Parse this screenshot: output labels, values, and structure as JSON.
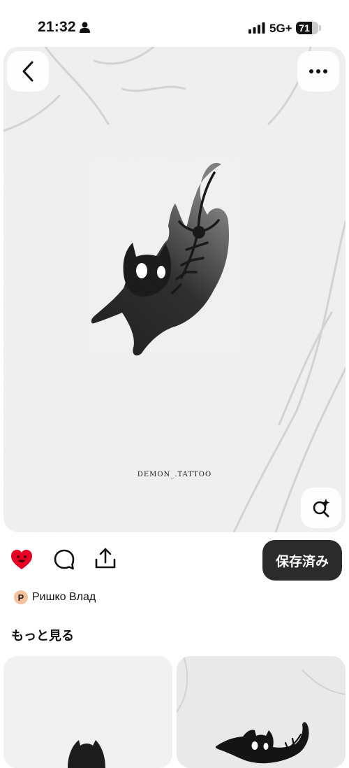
{
  "status_bar": {
    "time": "21:32",
    "network": "5G+",
    "battery": "71",
    "battery_level": 0.71
  },
  "pin": {
    "watermark": "DEMON_.TATTOO",
    "back_icon": "chevron-left-icon",
    "more_icon": "more-horizontal-icon",
    "lens_icon": "visual-search-icon"
  },
  "actions": {
    "like_icon": "heart-icon",
    "comment_icon": "comment-icon",
    "share_icon": "share-icon",
    "save_label": "保存済み",
    "like_color": "#e60023"
  },
  "creator": {
    "initial": "P",
    "name": "Ришко Влад",
    "avatar_color": "#f6c29e"
  },
  "more_section": {
    "heading": "もっと見る"
  }
}
